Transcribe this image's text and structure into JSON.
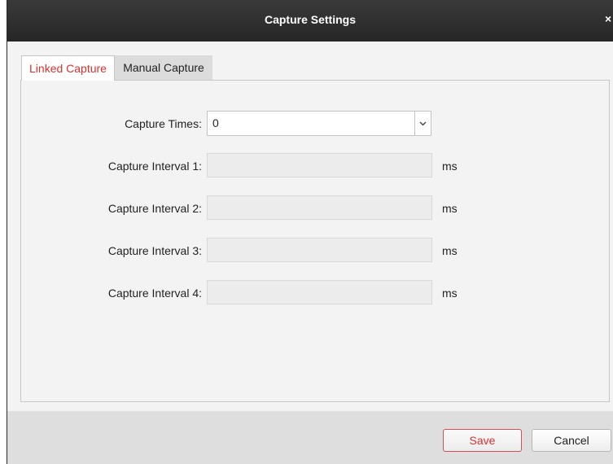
{
  "dialog": {
    "title": "Capture Settings",
    "close_glyph": "×"
  },
  "tabs": [
    {
      "label": "Linked Capture",
      "active": true
    },
    {
      "label": "Manual Capture",
      "active": false
    }
  ],
  "form": {
    "capture_times": {
      "label": "Capture Times:",
      "value": "0"
    },
    "intervals": [
      {
        "label": "Capture Interval 1:",
        "value": "",
        "unit": "ms"
      },
      {
        "label": "Capture Interval 2:",
        "value": "",
        "unit": "ms"
      },
      {
        "label": "Capture Interval 3:",
        "value": "",
        "unit": "ms"
      },
      {
        "label": "Capture Interval 4:",
        "value": "",
        "unit": "ms"
      }
    ]
  },
  "buttons": {
    "save": "Save",
    "cancel": "Cancel"
  },
  "colors": {
    "accent": "#d9312f",
    "titlebar": "#2d2d2d"
  },
  "icons": {
    "close": "close-icon",
    "dropdown": "chevron-down-icon"
  }
}
